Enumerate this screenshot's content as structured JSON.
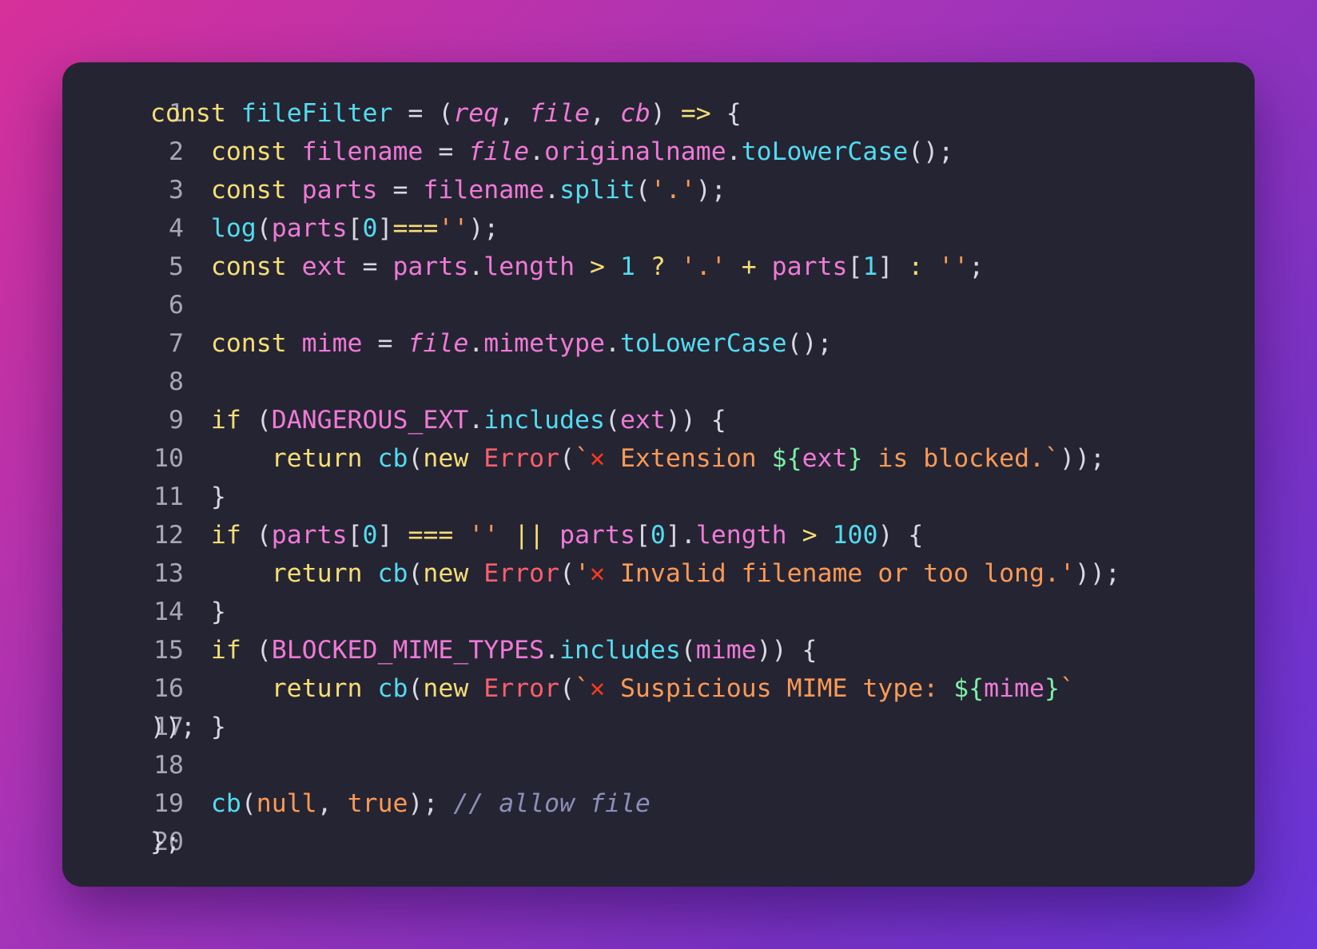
{
  "code_editor": {
    "lines": [
      {
        "number": "1",
        "tokens": [
          {
            "t": "const",
            "c": "kw"
          },
          {
            "t": " ",
            "c": "plain"
          },
          {
            "t": "fileFilter",
            "c": "fn"
          },
          {
            "t": " = (",
            "c": "plain"
          },
          {
            "t": "req",
            "c": "param"
          },
          {
            "t": ", ",
            "c": "plain"
          },
          {
            "t": "file",
            "c": "param"
          },
          {
            "t": ", ",
            "c": "plain"
          },
          {
            "t": "cb",
            "c": "param"
          },
          {
            "t": ") ",
            "c": "plain"
          },
          {
            "t": "=>",
            "c": "op"
          },
          {
            "t": " {",
            "c": "plain"
          }
        ]
      },
      {
        "number": "2",
        "tokens": [
          {
            "t": "    ",
            "c": "plain"
          },
          {
            "t": "const",
            "c": "kw"
          },
          {
            "t": " ",
            "c": "plain"
          },
          {
            "t": "filename",
            "c": "var"
          },
          {
            "t": " = ",
            "c": "plain"
          },
          {
            "t": "file",
            "c": "param"
          },
          {
            "t": ".",
            "c": "plain"
          },
          {
            "t": "originalname",
            "c": "var"
          },
          {
            "t": ".",
            "c": "plain"
          },
          {
            "t": "toLowerCase",
            "c": "fn"
          },
          {
            "t": "();",
            "c": "plain"
          }
        ]
      },
      {
        "number": "3",
        "tokens": [
          {
            "t": "    ",
            "c": "plain"
          },
          {
            "t": "const",
            "c": "kw"
          },
          {
            "t": " ",
            "c": "plain"
          },
          {
            "t": "parts",
            "c": "var"
          },
          {
            "t": " = ",
            "c": "plain"
          },
          {
            "t": "filename",
            "c": "var"
          },
          {
            "t": ".",
            "c": "plain"
          },
          {
            "t": "split",
            "c": "fn"
          },
          {
            "t": "(",
            "c": "plain"
          },
          {
            "t": "'.'",
            "c": "str"
          },
          {
            "t": ");",
            "c": "plain"
          }
        ]
      },
      {
        "number": "4",
        "tokens": [
          {
            "t": "    ",
            "c": "plain"
          },
          {
            "t": "log",
            "c": "fn"
          },
          {
            "t": "(",
            "c": "plain"
          },
          {
            "t": "parts",
            "c": "var"
          },
          {
            "t": "[",
            "c": "plain"
          },
          {
            "t": "0",
            "c": "num"
          },
          {
            "t": "]",
            "c": "plain"
          },
          {
            "t": "===",
            "c": "op"
          },
          {
            "t": "''",
            "c": "str"
          },
          {
            "t": ");",
            "c": "plain"
          }
        ]
      },
      {
        "number": "5",
        "tokens": [
          {
            "t": "    ",
            "c": "plain"
          },
          {
            "t": "const",
            "c": "kw"
          },
          {
            "t": " ",
            "c": "plain"
          },
          {
            "t": "ext",
            "c": "var"
          },
          {
            "t": " = ",
            "c": "plain"
          },
          {
            "t": "parts",
            "c": "var"
          },
          {
            "t": ".",
            "c": "plain"
          },
          {
            "t": "length",
            "c": "var"
          },
          {
            "t": " ",
            "c": "plain"
          },
          {
            "t": ">",
            "c": "op"
          },
          {
            "t": " ",
            "c": "plain"
          },
          {
            "t": "1",
            "c": "num"
          },
          {
            "t": " ",
            "c": "plain"
          },
          {
            "t": "?",
            "c": "op"
          },
          {
            "t": " ",
            "c": "plain"
          },
          {
            "t": "'.'",
            "c": "str"
          },
          {
            "t": " ",
            "c": "plain"
          },
          {
            "t": "+",
            "c": "op"
          },
          {
            "t": " ",
            "c": "plain"
          },
          {
            "t": "parts",
            "c": "var"
          },
          {
            "t": "[",
            "c": "plain"
          },
          {
            "t": "1",
            "c": "num"
          },
          {
            "t": "] ",
            "c": "plain"
          },
          {
            "t": ":",
            "c": "op"
          },
          {
            "t": " ",
            "c": "plain"
          },
          {
            "t": "''",
            "c": "str"
          },
          {
            "t": ";",
            "c": "plain"
          }
        ]
      },
      {
        "number": "6",
        "tokens": []
      },
      {
        "number": "7",
        "tokens": [
          {
            "t": "    ",
            "c": "plain"
          },
          {
            "t": "const",
            "c": "kw"
          },
          {
            "t": " ",
            "c": "plain"
          },
          {
            "t": "mime",
            "c": "var"
          },
          {
            "t": " = ",
            "c": "plain"
          },
          {
            "t": "file",
            "c": "param"
          },
          {
            "t": ".",
            "c": "plain"
          },
          {
            "t": "mimetype",
            "c": "var"
          },
          {
            "t": ".",
            "c": "plain"
          },
          {
            "t": "toLowerCase",
            "c": "fn"
          },
          {
            "t": "();",
            "c": "plain"
          }
        ]
      },
      {
        "number": "8",
        "tokens": []
      },
      {
        "number": "9",
        "tokens": [
          {
            "t": "    ",
            "c": "plain"
          },
          {
            "t": "if",
            "c": "kw"
          },
          {
            "t": " (",
            "c": "plain"
          },
          {
            "t": "DANGEROUS_EXT",
            "c": "var"
          },
          {
            "t": ".",
            "c": "plain"
          },
          {
            "t": "includes",
            "c": "fn"
          },
          {
            "t": "(",
            "c": "plain"
          },
          {
            "t": "ext",
            "c": "var"
          },
          {
            "t": ")) {",
            "c": "plain"
          }
        ]
      },
      {
        "number": "10",
        "tokens": [
          {
            "t": "        ",
            "c": "plain"
          },
          {
            "t": "return",
            "c": "kw"
          },
          {
            "t": " ",
            "c": "plain"
          },
          {
            "t": "cb",
            "c": "fn"
          },
          {
            "t": "(",
            "c": "plain"
          },
          {
            "t": "new",
            "c": "kw"
          },
          {
            "t": " ",
            "c": "plain"
          },
          {
            "t": "Error",
            "c": "cls"
          },
          {
            "t": "(",
            "c": "plain"
          },
          {
            "t": "`",
            "c": "str"
          },
          {
            "t": "✕",
            "c": "emoji"
          },
          {
            "t": " Extension ",
            "c": "str"
          },
          {
            "t": "${",
            "c": "interp"
          },
          {
            "t": "ext",
            "c": "var"
          },
          {
            "t": "}",
            "c": "interp"
          },
          {
            "t": " is blocked.`",
            "c": "str"
          },
          {
            "t": "));",
            "c": "plain"
          }
        ]
      },
      {
        "number": "11",
        "tokens": [
          {
            "t": "    }",
            "c": "plain"
          }
        ]
      },
      {
        "number": "12",
        "tokens": [
          {
            "t": "    ",
            "c": "plain"
          },
          {
            "t": "if",
            "c": "kw"
          },
          {
            "t": " (",
            "c": "plain"
          },
          {
            "t": "parts",
            "c": "var"
          },
          {
            "t": "[",
            "c": "plain"
          },
          {
            "t": "0",
            "c": "num"
          },
          {
            "t": "] ",
            "c": "plain"
          },
          {
            "t": "===",
            "c": "op"
          },
          {
            "t": " ",
            "c": "plain"
          },
          {
            "t": "''",
            "c": "str"
          },
          {
            "t": " ",
            "c": "plain"
          },
          {
            "t": "||",
            "c": "op"
          },
          {
            "t": " ",
            "c": "plain"
          },
          {
            "t": "parts",
            "c": "var"
          },
          {
            "t": "[",
            "c": "plain"
          },
          {
            "t": "0",
            "c": "num"
          },
          {
            "t": "].",
            "c": "plain"
          },
          {
            "t": "length",
            "c": "var"
          },
          {
            "t": " ",
            "c": "plain"
          },
          {
            "t": ">",
            "c": "op"
          },
          {
            "t": " ",
            "c": "plain"
          },
          {
            "t": "100",
            "c": "num"
          },
          {
            "t": ") {",
            "c": "plain"
          }
        ]
      },
      {
        "number": "13",
        "tokens": [
          {
            "t": "        ",
            "c": "plain"
          },
          {
            "t": "return",
            "c": "kw"
          },
          {
            "t": " ",
            "c": "plain"
          },
          {
            "t": "cb",
            "c": "fn"
          },
          {
            "t": "(",
            "c": "plain"
          },
          {
            "t": "new",
            "c": "kw"
          },
          {
            "t": " ",
            "c": "plain"
          },
          {
            "t": "Error",
            "c": "cls"
          },
          {
            "t": "(",
            "c": "plain"
          },
          {
            "t": "'",
            "c": "str"
          },
          {
            "t": "✕",
            "c": "emoji"
          },
          {
            "t": " Invalid filename or too long.'",
            "c": "str"
          },
          {
            "t": "));",
            "c": "plain"
          }
        ]
      },
      {
        "number": "14",
        "tokens": [
          {
            "t": "    }",
            "c": "plain"
          }
        ]
      },
      {
        "number": "15",
        "tokens": [
          {
            "t": "    ",
            "c": "plain"
          },
          {
            "t": "if",
            "c": "kw"
          },
          {
            "t": " (",
            "c": "plain"
          },
          {
            "t": "BLOCKED_MIME_TYPES",
            "c": "var"
          },
          {
            "t": ".",
            "c": "plain"
          },
          {
            "t": "includes",
            "c": "fn"
          },
          {
            "t": "(",
            "c": "plain"
          },
          {
            "t": "mime",
            "c": "var"
          },
          {
            "t": ")) {",
            "c": "plain"
          }
        ]
      },
      {
        "number": "16",
        "tokens": [
          {
            "t": "        ",
            "c": "plain"
          },
          {
            "t": "return",
            "c": "kw"
          },
          {
            "t": " ",
            "c": "plain"
          },
          {
            "t": "cb",
            "c": "fn"
          },
          {
            "t": "(",
            "c": "plain"
          },
          {
            "t": "new",
            "c": "kw"
          },
          {
            "t": " ",
            "c": "plain"
          },
          {
            "t": "Error",
            "c": "cls"
          },
          {
            "t": "(",
            "c": "plain"
          },
          {
            "t": "`",
            "c": "str"
          },
          {
            "t": "✕",
            "c": "emoji"
          },
          {
            "t": " Suspicious MIME type: ",
            "c": "str"
          },
          {
            "t": "${",
            "c": "interp"
          },
          {
            "t": "mime",
            "c": "var"
          },
          {
            "t": "}",
            "c": "interp"
          },
          {
            "t": "`",
            "c": "str"
          }
        ]
      },
      {
        "number": "17",
        "tokens": [
          {
            "t": ")); }",
            "c": "plain"
          }
        ]
      },
      {
        "number": "18",
        "tokens": []
      },
      {
        "number": "19",
        "tokens": [
          {
            "t": "    ",
            "c": "plain"
          },
          {
            "t": "cb",
            "c": "fn"
          },
          {
            "t": "(",
            "c": "plain"
          },
          {
            "t": "null",
            "c": "null"
          },
          {
            "t": ", ",
            "c": "plain"
          },
          {
            "t": "true",
            "c": "null"
          },
          {
            "t": "); ",
            "c": "plain"
          },
          {
            "t": "// allow file",
            "c": "comment"
          }
        ]
      },
      {
        "number": "20",
        "tokens": [
          {
            "t": "};",
            "c": "plain"
          }
        ]
      }
    ]
  }
}
